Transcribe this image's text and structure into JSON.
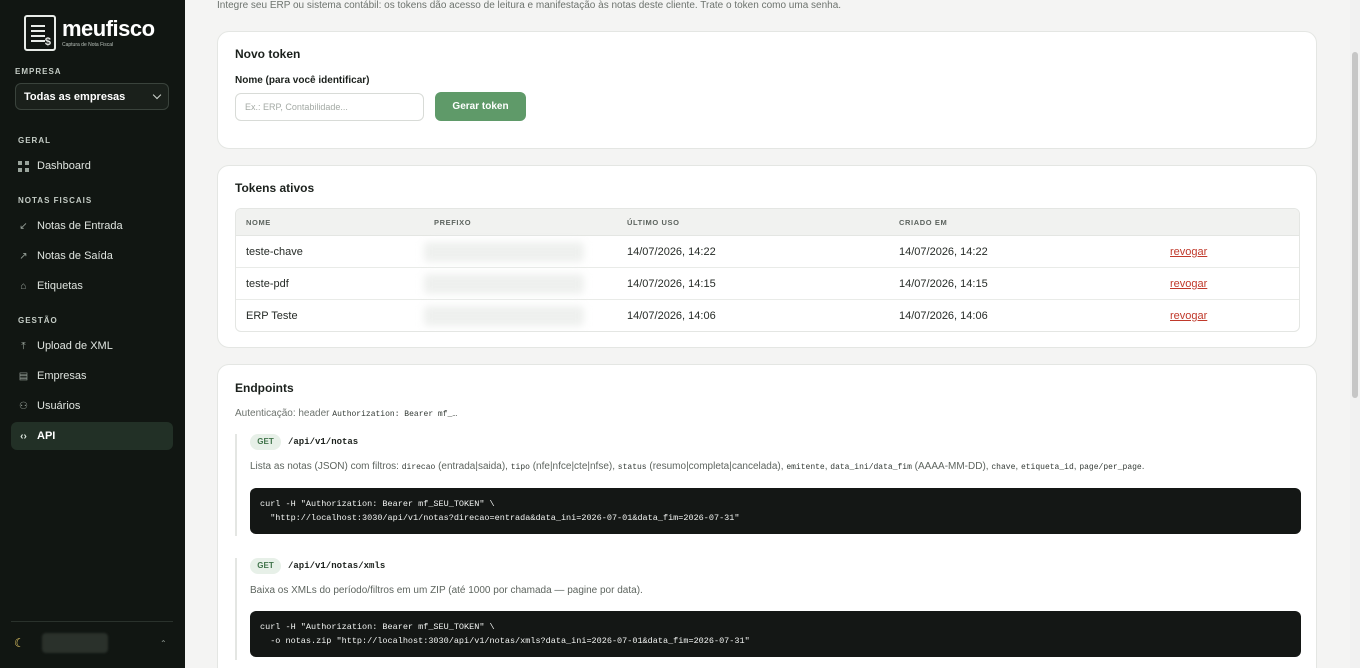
{
  "brand": {
    "name": "meufisco",
    "tagline": "Captura de Nota Fiscal"
  },
  "sidebar": {
    "company_label": "EMPRESA",
    "company_selected": "Todas as empresas",
    "groups": {
      "geral": "GERAL",
      "notas": "NOTAS FISCAIS",
      "gestao": "GESTÃO"
    },
    "items": [
      {
        "label": "Dashboard",
        "icon": "grid-icon"
      },
      {
        "label": "Notas de Entrada",
        "icon": "arrow-down-left-icon"
      },
      {
        "label": "Notas de Saída",
        "icon": "arrow-up-right-icon"
      },
      {
        "label": "Etiquetas",
        "icon": "tag-icon"
      },
      {
        "label": "Upload de XML",
        "icon": "upload-icon"
      },
      {
        "label": "Empresas",
        "icon": "building-icon"
      },
      {
        "label": "Usuários",
        "icon": "users-icon"
      },
      {
        "label": "API",
        "icon": "code-icon",
        "active": true
      }
    ],
    "theme_icon": "moon-icon"
  },
  "intro": "Integre seu ERP ou sistema contábil: os tokens dão acesso de leitura e manifestação às notas deste cliente. Trate o token como uma senha.",
  "new_token": {
    "title": "Novo token",
    "name_label": "Nome (para você identificar)",
    "name_placeholder": "Ex.: ERP, Contabilidade...",
    "name_value": "",
    "button": "Gerar token"
  },
  "tokens": {
    "title": "Tokens ativos",
    "columns": [
      "NOME",
      "PREFIXO",
      "ÚLTIMO USO",
      "CRIADO EM"
    ],
    "rows": [
      {
        "name": "teste-chave",
        "last_used": "14/07/2026, 14:22",
        "created": "14/07/2026, 14:22",
        "action": "revogar"
      },
      {
        "name": "teste-pdf",
        "last_used": "14/07/2026, 14:15",
        "created": "14/07/2026, 14:15",
        "action": "revogar"
      },
      {
        "name": "ERP Teste",
        "last_used": "14/07/2026, 14:06",
        "created": "14/07/2026, 14:06",
        "action": "revogar"
      }
    ]
  },
  "endpoints": {
    "title": "Endpoints",
    "auth_prefix": "Autenticação: header",
    "auth_code": "Authorization: Bearer mf_…",
    "list": [
      {
        "method": "GET",
        "path": "/api/v1/notas",
        "desc": {
          "t1": "Lista as notas (JSON) com filtros: ",
          "c1": "direcao",
          "t2": " (entrada|saida), ",
          "c2": "tipo",
          "t3": " (nfe|nfce|cte|nfse), ",
          "c3": "status",
          "t4": " (resumo|completa|cancelada), ",
          "c4": "emitente",
          "t5": ", ",
          "c5": "data_ini/data_fim",
          "t6": " (AAAA-MM-DD), ",
          "c6": "chave",
          "t7": ", ",
          "c7": "etiqueta_id",
          "t8": ", ",
          "c8": "page/per_page",
          "t9": "."
        },
        "code": "curl -H \"Authorization: Bearer mf_SEU_TOKEN\" \\\n  \"http://localhost:3030/api/v1/notas?direcao=entrada&data_ini=2026-07-01&data_fim=2026-07-31\""
      },
      {
        "method": "GET",
        "path": "/api/v1/notas/xmls",
        "desc_text": "Baixa os XMLs do período/filtros em um ZIP (até 1000 por chamada — pagine por data).",
        "code": "curl -H \"Authorization: Bearer mf_SEU_TOKEN\" \\\n  -o notas.zip \"http://localhost:3030/api/v1/notas/xmls?data_ini=2026-07-01&data_fim=2026-07-31\""
      }
    ]
  },
  "colors": {
    "sidebar_bg": "#111612",
    "accent": "#5f9a69",
    "danger": "#c0392b"
  }
}
